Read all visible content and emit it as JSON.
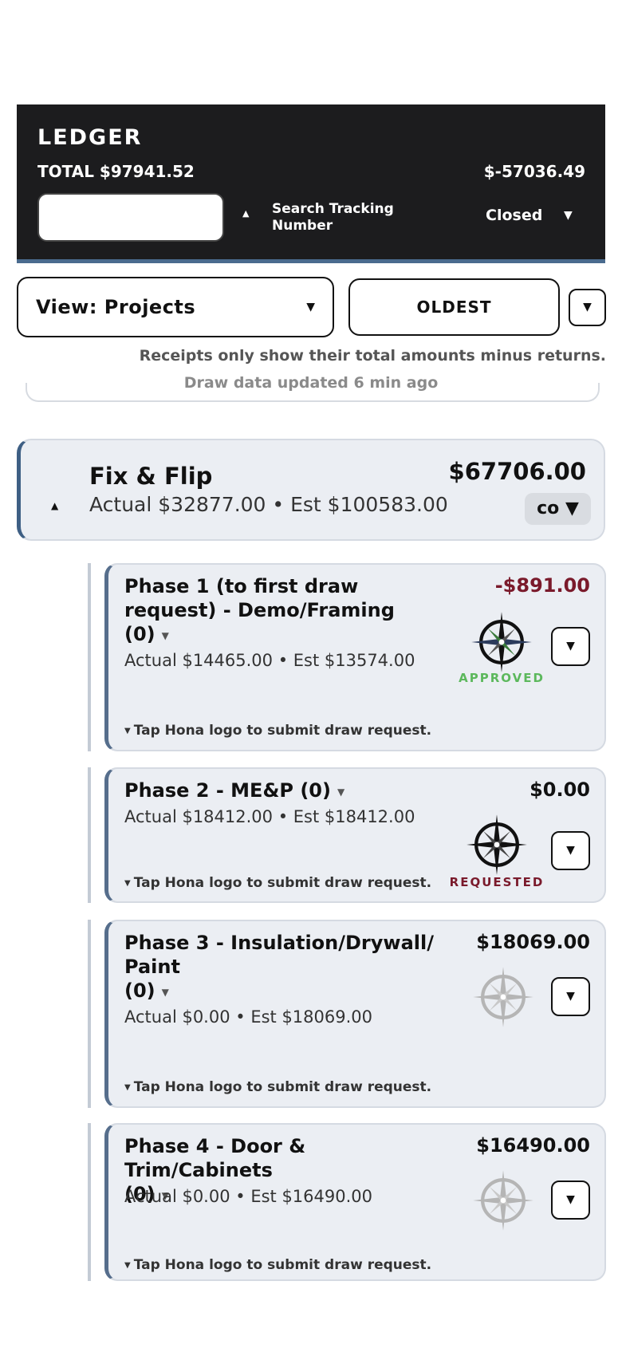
{
  "header": {
    "brand": "LEDGER",
    "total": "TOTAL $97941.52",
    "balance": "$-57036.49",
    "search_placeholder": "",
    "sort_arrow": "▲",
    "search_label": "Search Tracking Number",
    "status": "Closed",
    "status_caret": "▼"
  },
  "controls": {
    "view_label": "View: Projects",
    "view_caret": "▼",
    "sort_label": "OLDEST",
    "sort_dir": "▼"
  },
  "notice": "Receipts only show their total amounts minus returns.",
  "updated": "Draw data updated 6 min ago",
  "project": {
    "collapse_caret": "▲",
    "name": "Fix & Flip",
    "summary": "Actual $32877.00 • Est $100583.00",
    "amount": "$67706.00",
    "badge": "co ▼"
  },
  "phases": [
    {
      "title": "Phase 1 (to first draw request) - Demo/Framing",
      "count": "(0)",
      "count_caret": "▼",
      "summary": "Actual $14465.00 • Est $13574.00",
      "amount": "-$891.00",
      "status": "APPROVED",
      "hint": "Tap Hona logo to submit draw request.",
      "expand": "▼"
    },
    {
      "title": "Phase 2 - ME&P",
      "count": "(0)",
      "count_caret": "▼",
      "summary": "Actual $18412.00 • Est $18412.00",
      "amount": "$0.00",
      "status": "REQUESTED",
      "hint": "Tap Hona logo to submit draw request.",
      "expand": "▼"
    },
    {
      "title": "Phase 3 - Insulation/Drywall/ Paint",
      "count": "(0)",
      "count_caret": "▼",
      "summary": "Actual $0.00 • Est $18069.00",
      "amount": "$18069.00",
      "status": "",
      "hint": "Tap Hona logo to submit draw request.",
      "expand": "▼"
    },
    {
      "title": "Phase 4 - Door & Trim/Cabinets",
      "count": "(0)",
      "count_caret": "▼",
      "summary": "Actual $0.00 • Est $16490.00",
      "amount": "$16490.00",
      "status": "",
      "hint": "Tap Hona logo to submit draw request.",
      "expand": "▼"
    }
  ],
  "hint_caret": "▼",
  "colors": {
    "header_bg": "#1c1c1e",
    "accent": "#3e5f84",
    "approved": "#5cb85c",
    "requested": "#7a1a2b",
    "negative": "#7a1a2b",
    "card_bg": "#ebeef3"
  },
  "icons": [
    "compass-logo-icon",
    "chevron-down-icon",
    "sort-arrow-icon"
  ]
}
